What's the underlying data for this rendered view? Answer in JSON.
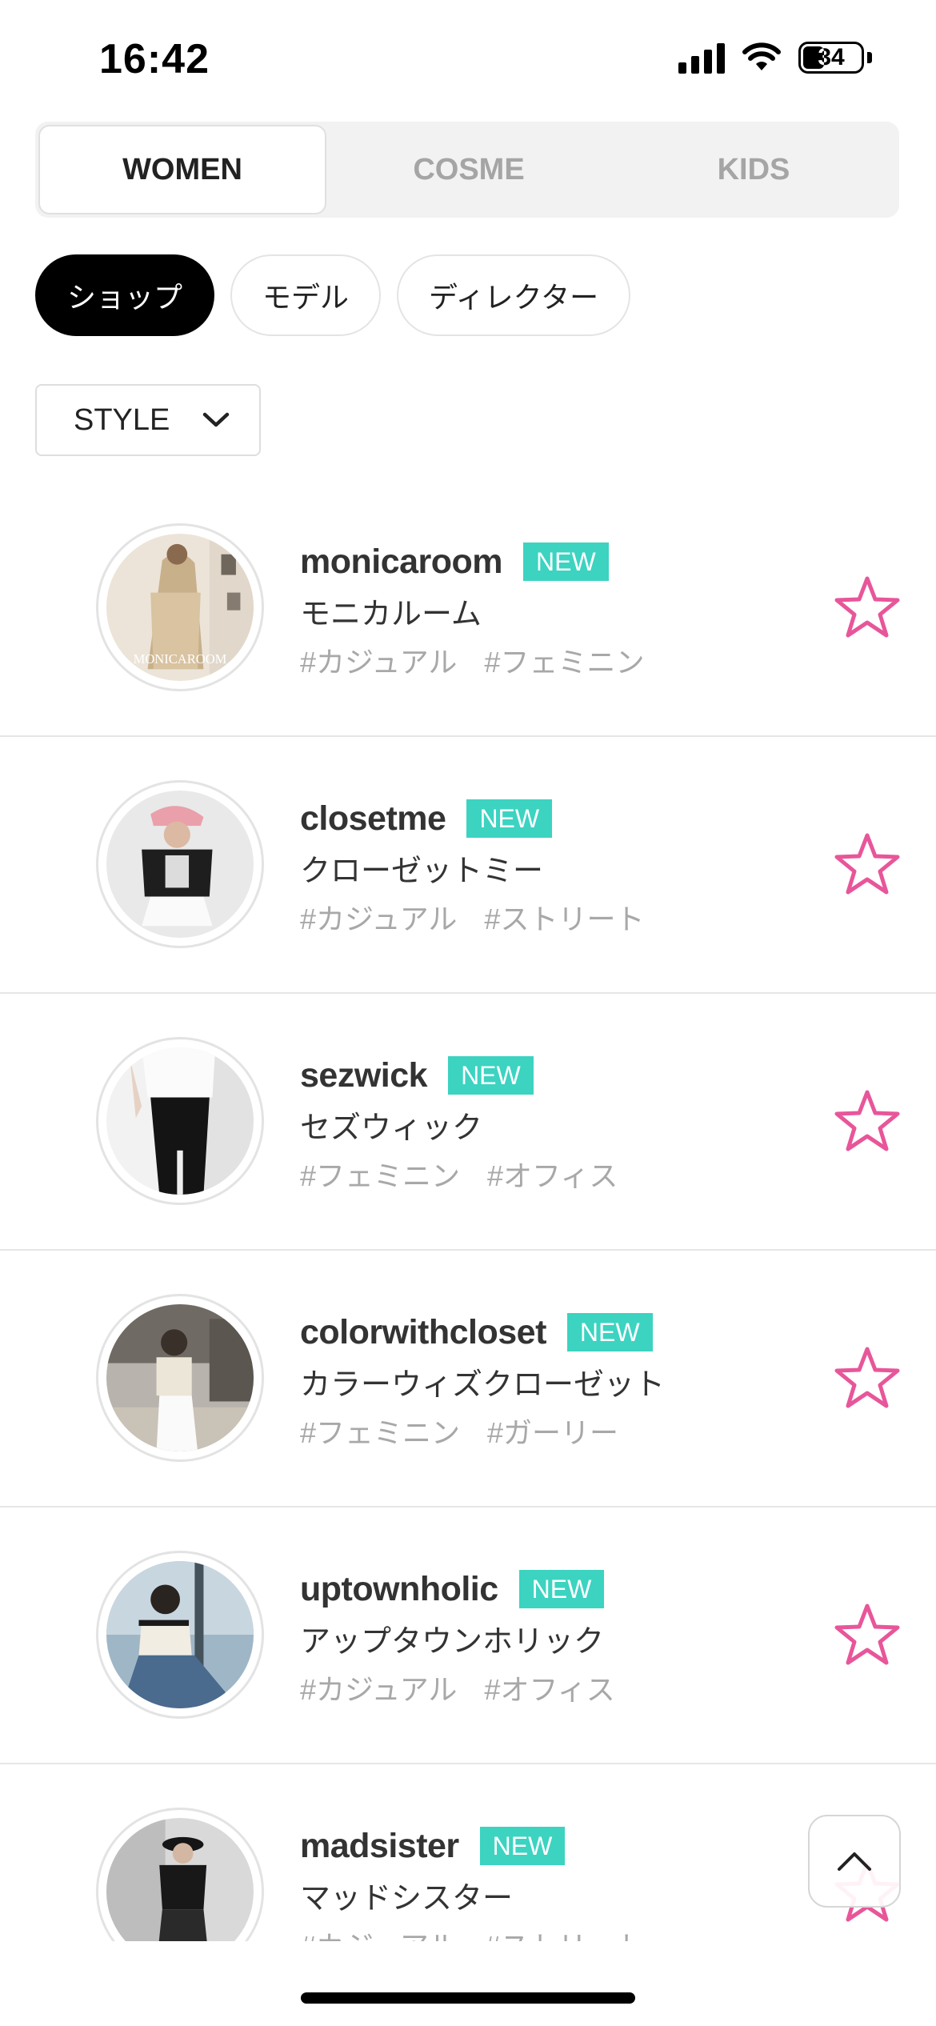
{
  "status_bar": {
    "time": "16:42",
    "battery": "34"
  },
  "category_tabs": [
    {
      "label": "WOMEN",
      "active": true
    },
    {
      "label": "COSME",
      "active": false
    },
    {
      "label": "KIDS",
      "active": false
    }
  ],
  "filter_chips": [
    {
      "label": "ショップ",
      "active": true
    },
    {
      "label": "モデル",
      "active": false
    },
    {
      "label": "ディレクター",
      "active": false
    }
  ],
  "style_dropdown": {
    "label": "STYLE",
    "icon": "chevron-down-icon"
  },
  "badge_label": "NEW",
  "accent_colors": {
    "badge": "#3cd3c1",
    "star": "#e8569a"
  },
  "shops": [
    {
      "name": "monicaroom",
      "jp_name": "モニカルーム",
      "tags": [
        "#カジュアル",
        "#フェミニン"
      ],
      "avatar_watermark": "MONICAROOM"
    },
    {
      "name": "closetme",
      "jp_name": "クローゼットミー",
      "tags": [
        "#カジュアル",
        "#ストリート"
      ]
    },
    {
      "name": "sezwick",
      "jp_name": "セズウィック",
      "tags": [
        "#フェミニン",
        "#オフィス"
      ]
    },
    {
      "name": "colorwithcloset",
      "jp_name": "カラーウィズクローゼット",
      "tags": [
        "#フェミニン",
        "#ガーリー"
      ]
    },
    {
      "name": "uptownholic",
      "jp_name": "アップタウンホリック",
      "tags": [
        "#カジュアル",
        "#オフィス"
      ]
    },
    {
      "name": "madsister",
      "jp_name": "マッドシスター",
      "tags": [
        "#カジュアル",
        "#ストリート"
      ]
    }
  ],
  "scroll_top_icon": "chevron-up-icon"
}
